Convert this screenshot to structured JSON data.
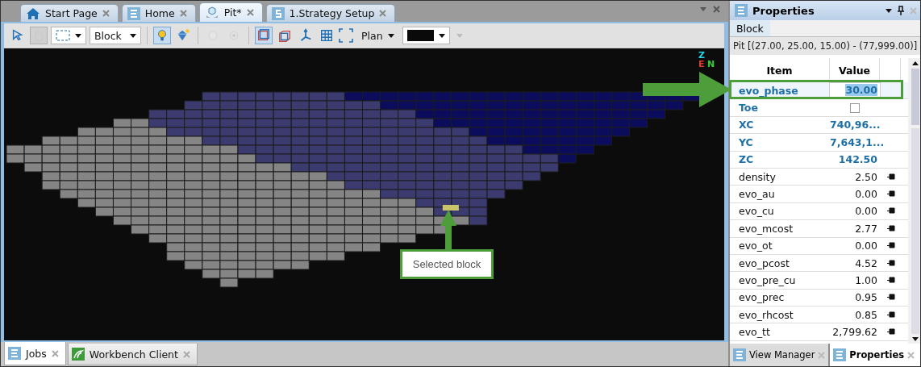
{
  "document_tabs": [
    {
      "label": "Start Page",
      "kind": "home",
      "selected": false
    },
    {
      "label": "Home",
      "kind": "list",
      "selected": false
    },
    {
      "label": "Pit*",
      "kind": "pit",
      "selected": true
    },
    {
      "label": "1.Strategy Setup",
      "kind": "strategy",
      "selected": false
    }
  ],
  "toolbar": {
    "items": [
      {
        "kind": "pointer",
        "pressed": false,
        "disabled": false
      },
      {
        "kind": "hand",
        "pressed": true,
        "disabled": true
      },
      {
        "kind": "marquee"
      },
      {
        "kind": "type",
        "value": "Block"
      },
      {
        "kind": "sep"
      },
      {
        "kind": "bulb",
        "pressed": true,
        "disabled": false
      },
      {
        "kind": "gem",
        "pressed": false,
        "disabled": false
      },
      {
        "kind": "sep"
      },
      {
        "kind": "cubeA",
        "pressed": false,
        "disabled": true
      },
      {
        "kind": "cubeB",
        "pressed": false,
        "disabled": true
      },
      {
        "kind": "sep"
      },
      {
        "kind": "box",
        "pressed": true,
        "disabled": false
      },
      {
        "kind": "boxTilt",
        "pressed": false,
        "disabled": false
      },
      {
        "kind": "axes",
        "pressed": false,
        "disabled": false
      },
      {
        "kind": "grid",
        "pressed": false,
        "disabled": false
      },
      {
        "kind": "view",
        "value": "Plan"
      },
      {
        "kind": "color",
        "color": "#0a0a0a"
      }
    ]
  },
  "viewport": {
    "axis_labels": [
      {
        "text": "Z",
        "color": "#22d3e6"
      },
      {
        "text": "E",
        "color": "#e23b2e"
      },
      {
        "text": "N",
        "color": "#2fd12f"
      }
    ],
    "callout": "Selected block"
  },
  "bottom_tabs": [
    {
      "label": "Jobs",
      "kind": "list",
      "selected": true
    },
    {
      "label": "Workbench Client",
      "kind": "client",
      "selected": false
    }
  ],
  "properties": {
    "title": "Properties",
    "tab": "Block",
    "path": "Pit [(27.00, 25.00, 15.00) - (77,999.00)]",
    "columns": [
      "Item",
      "Value"
    ],
    "rows": [
      {
        "name": "evo_phase",
        "value": "30.00",
        "kind": "key",
        "selected": true
      },
      {
        "name": "Toe",
        "kind": "check",
        "checked": false,
        "selected": false
      },
      {
        "name": "XC",
        "value": "740,96...",
        "kind": "key",
        "selected": false
      },
      {
        "name": "YC",
        "value": "7,643,1...",
        "kind": "key",
        "selected": false
      },
      {
        "name": "ZC",
        "value": "142.50",
        "kind": "key",
        "selected": false
      },
      {
        "name": "density",
        "value": "2.50",
        "kind": "attr",
        "selected": false
      },
      {
        "name": "evo_au",
        "value": "0.00",
        "kind": "attr",
        "selected": false
      },
      {
        "name": "evo_cu",
        "value": "0.00",
        "kind": "attr",
        "selected": false
      },
      {
        "name": "evo_mcost",
        "value": "2.77",
        "kind": "attr",
        "selected": false
      },
      {
        "name": "evo_ot",
        "value": "0.00",
        "kind": "attr",
        "selected": false
      },
      {
        "name": "evo_pcost",
        "value": "4.52",
        "kind": "attr",
        "selected": false
      },
      {
        "name": "evo_pre_cu",
        "value": "1.00",
        "kind": "attr",
        "selected": false
      },
      {
        "name": "evo_prec",
        "value": "0.95",
        "kind": "attr",
        "selected": false
      },
      {
        "name": "evo_rhcost",
        "value": "0.85",
        "kind": "attr",
        "selected": false
      },
      {
        "name": "evo_tt",
        "value": "2,799.62",
        "kind": "attr",
        "selected": false
      }
    ],
    "bottom_tabs": [
      {
        "label": "View Manager",
        "selected": false
      },
      {
        "label": "Properties",
        "selected": true
      }
    ]
  }
}
